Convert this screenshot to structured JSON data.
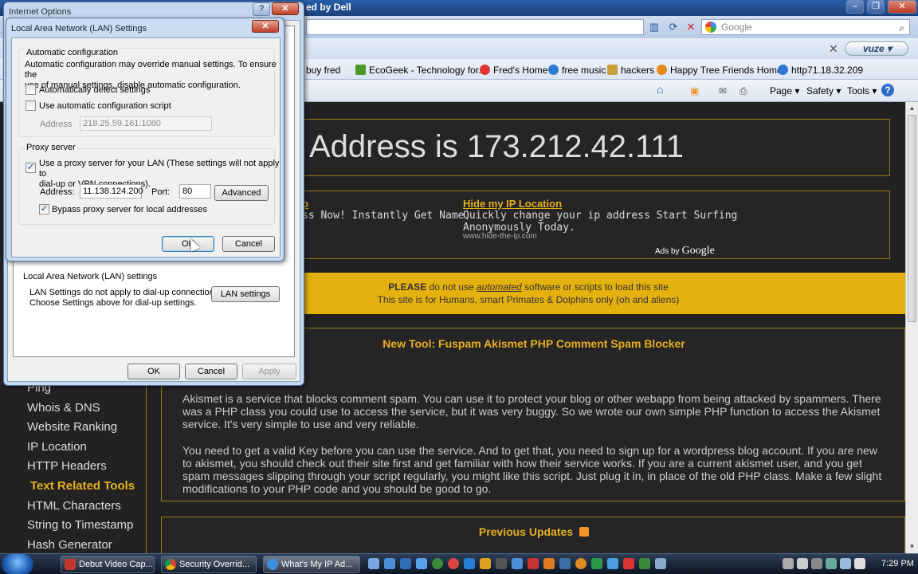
{
  "browser": {
    "title_fragment": "ed by Dell",
    "search_placeholder": "Google",
    "toolbar_brand": "vuze",
    "favorites": [
      {
        "label": "buy fred",
        "icon": "page-icon"
      },
      {
        "label": "EcoGeek - Technology for...",
        "icon": "leaf-icon"
      },
      {
        "label": "Fred's Home",
        "icon": "eye-icon"
      },
      {
        "label": "free music",
        "icon": "ie-icon"
      },
      {
        "label": "hackers",
        "icon": "folder-icon"
      },
      {
        "label": "Happy Tree Friends Home",
        "icon": "htf-icon"
      },
      {
        "label": "http71.18.32.209",
        "icon": "ie-icon"
      }
    ],
    "command_bar": {
      "page": "Page",
      "safety": "Safety",
      "tools": "Tools",
      "help": "?"
    }
  },
  "page": {
    "ip_heading": "Address is 173.212.42.111",
    "ads": [
      {
        "title": "p",
        "text": "ss Now! Instantly Get Name",
        "url": ""
      },
      {
        "title": "Hide my IP Location",
        "text": "Quickly change your ip address Start Surfing\nAnonymously Today.",
        "url": "www.hide-the-ip.com"
      }
    ],
    "ads_by": "Ads by",
    "ads_by_brand": "Google",
    "notice": {
      "please": "PLEASE",
      "pre": " do not use ",
      "link": "automated",
      "post": " software or scripts to load this site",
      "line2": "This site is for Humans, smart Primates & Dolphins only (oh and aliens)"
    },
    "tool_title": "New Tool: Fuspam Akismet PHP Comment Spam Blocker",
    "paragraphs": [
      "Akismet is a service that blocks comment spam. You can use it to protect your blog or other webapp from being attacked by spammers. There was a PHP class you could use to access the service, but it was very buggy. So we wrote our own simple PHP function to access the Akismet service. It's very simple to use and very reliable.",
      "You need to get a valid Key before you can use the service. And to get that, you need to sign up for a wordpress blog account. If you are new to akismet, you should check out their site first and get familiar with how their service works. If you are a current akismet user, and you get spam messages slipping through your script regularly, you might like this script. Just plug it in, in place of the old PHP class. Make a few slight modifications to your PHP code and you should be good to go."
    ],
    "previous_updates": "Previous Updates",
    "sidenav": [
      "Ping",
      "Whois & DNS",
      "Website Ranking",
      "IP Location",
      "HTTP Headers",
      "Text Related Tools",
      "HTML Characters",
      "String to Timestamp",
      "Hash Generator"
    ]
  },
  "internet_options": {
    "title": "Internet Options",
    "lan_group": "Local Area Network (LAN) settings",
    "lan_text": "LAN Settings do not apply to dial-up connections.\nChoose Settings above for dial-up settings.",
    "lan_button": "LAN settings",
    "ok": "OK",
    "cancel": "Cancel",
    "apply": "Apply"
  },
  "lan_dialog": {
    "title": "Local Area Network (LAN) Settings",
    "auto_group": "Automatic configuration",
    "auto_desc": "Automatic configuration may override manual settings.  To ensure the\nuse of manual settings, disable automatic configuration.",
    "auto_detect": "Automatically detect settings",
    "auto_detect_checked": false,
    "use_script": "Use automatic configuration script",
    "use_script_checked": false,
    "script_address_label": "Address",
    "script_address_value": "218.25.59.161:1080",
    "proxy_group": "Proxy server",
    "use_proxy": "Use a proxy server for your LAN (These settings will not apply to\ndial-up or VPN connections).",
    "use_proxy_checked": true,
    "proxy_address_label": "Address:",
    "proxy_address_value": "11.138.124.200",
    "port_label": "Port:",
    "port_value": "80",
    "advanced": "Advanced",
    "bypass": "Bypass proxy server for local addresses",
    "bypass_checked": true,
    "ok": "OK",
    "cancel": "Cancel"
  },
  "taskbar": {
    "tasks": [
      {
        "label": "Debut Video Cap...",
        "active": false
      },
      {
        "label": "Security Overrid...",
        "active": false
      },
      {
        "label": "What's My IP Ad...",
        "active": true
      }
    ],
    "clock": "7:29 PM"
  },
  "colors": {
    "accent": "#e8b020",
    "notice_bg": "#e5b10f",
    "page_bg": "#222222"
  }
}
